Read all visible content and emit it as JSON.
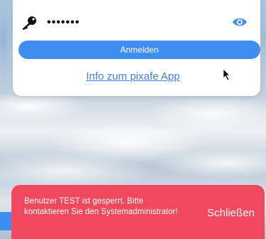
{
  "login": {
    "password_masked": "•••••••",
    "submit_label": "Anmelden",
    "info_link": "Info zum pixafe App"
  },
  "toast": {
    "message": "Benutzer TEST ist gesperrt. Bitte kontaktieren Sie den Systemadministrator!",
    "close_label": "Schließen"
  },
  "icons": [
    "key-icon",
    "eye-icon",
    "cursor-icon"
  ],
  "colors": {
    "accent": "#3d8ef0",
    "error": "#f0485c",
    "link": "#3d7fe0"
  }
}
